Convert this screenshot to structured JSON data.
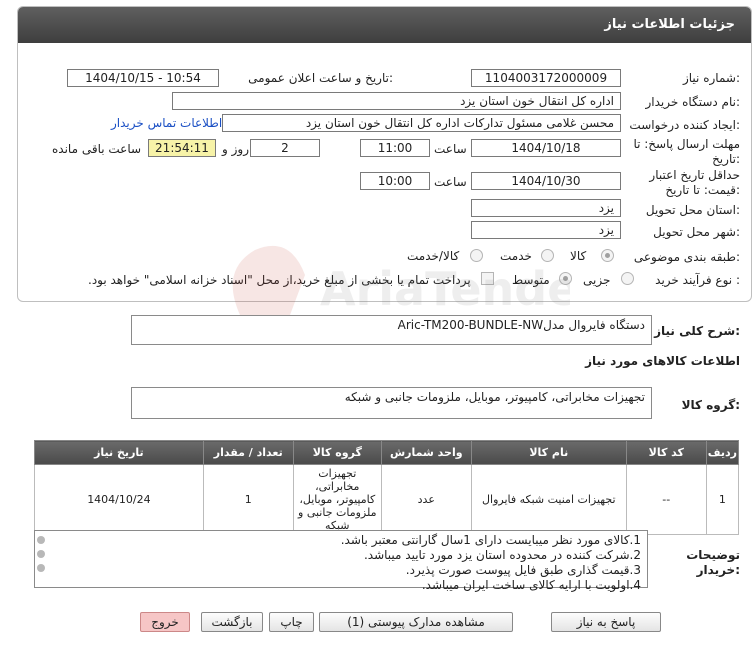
{
  "header": {
    "title": "جزئیات اطلاعات نیاز"
  },
  "form": {
    "need_number_label": "شماره نیاز:",
    "need_number": "1104003172000009",
    "announce_label": "تاریخ و ساعت اعلان عمومی:",
    "announce_value": "1404/10/15 - 10:54",
    "buyer_label": "نام دستگاه خریدار:",
    "buyer_value": "اداره کل انتقال خون استان یزد",
    "creator_label": "ایجاد کننده درخواست:",
    "creator_value": "محسن غلامی مسئول تدارکات اداره کل انتقال خون استان یزد",
    "contact_link": "اطلاعات تماس خریدار",
    "reply_label_1": "مهلت ارسال پاسخ: تا",
    "reply_label_2": "تاریخ:",
    "reply_date": "1404/10/18",
    "time_label": "ساعت",
    "reply_time": "11:00",
    "days_value": "2",
    "days_label": "روز و",
    "remaining_time": "21:54:11",
    "remaining_label": "ساعت باقی مانده",
    "validity_label_1": "حداقل تاریخ اعتبار",
    "validity_label_2": "قیمت: تا تاریخ:",
    "validity_date": "1404/10/30",
    "validity_time": "10:00",
    "province_label": "استان محل تحویل:",
    "province_value": "یزد",
    "city_label": "شهر محل تحویل:",
    "city_value": "یزد",
    "category_label": "طبقه بندی موضوعی:",
    "category_options": [
      "کالا",
      "خدمت",
      "کالا/خدمت"
    ],
    "process_label": "نوع فرآیند خرید :",
    "process_options": [
      "جزیی",
      "متوسط"
    ],
    "payment_text": "پرداخت تمام یا بخشی از مبلغ خرید،از محل \"اسناد خزانه اسلامی\" خواهد بود."
  },
  "summary": {
    "label": "شرح کلی نیاز:",
    "value": "دستگاه فایروال مدلAric-TM200-BUNDLE-NW",
    "goods_info_label": "اطلاعات کالاهای مورد نیاز",
    "group_label": "گروه کالا:",
    "group_value": "تجهیزات مخابراتی، کامپیوتر، موبایل، ملزومات جانبی و شبکه"
  },
  "table": {
    "headers": [
      "ردیف",
      "کد کالا",
      "نام کالا",
      "واحد شمارش",
      "گروه کالا",
      "تعداد / مقدار",
      "تاریخ نیاز"
    ],
    "rows": [
      [
        "1",
        "--",
        "تجهیزات امنیت شبکه فایروال",
        "عدد",
        "تجهیزات مخابراتی، کامپیوتر، موبایل، ملزومات جانبی و شبکه",
        "1",
        "1404/10/24"
      ]
    ]
  },
  "notes": {
    "label_1": "توضیحات",
    "label_2": "خریدار:",
    "lines": [
      "1.کالای مورد نظر میبایست دارای 1سال گارانتی معتبر باشد.",
      "2.شرکت کننده در محدوده استان یزد مورد تایید میباشد.",
      "3.قیمت گذاری طبق فایل پیوست صورت پذیرد.",
      "4.اولویت با ارایه کالای ساخت ایران میباشد."
    ]
  },
  "buttons": {
    "reply": "پاسخ به نیاز",
    "docs": "مشاهده مدارک پیوستی (1)",
    "print": "چاپ",
    "back": "بازگشت",
    "exit": "خروج"
  },
  "watermark": {
    "text": "AriaTender.net"
  },
  "colors": {
    "header_bg": "#4a4a4a",
    "link": "#1a4fc4",
    "timer_bg": "#f7f3a8",
    "exit_bg": "#f6c6c6"
  }
}
